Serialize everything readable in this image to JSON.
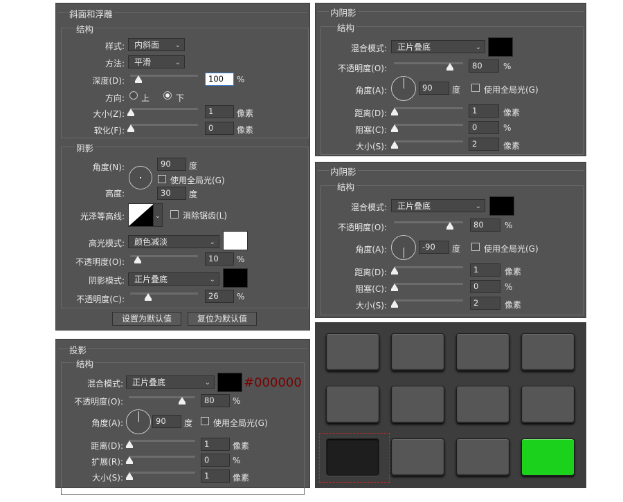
{
  "bevel": {
    "title": "斜面和浮雕",
    "structure_title": "结构",
    "style_label": "样式:",
    "style_value": "内斜面",
    "method_label": "方法:",
    "method_value": "平滑",
    "depth_label": "深度(D):",
    "depth_value": "100",
    "depth_unit": "%",
    "direction_label": "方向:",
    "dir_up": "上",
    "dir_down": "下",
    "size_label": "大小(Z):",
    "size_value": "1",
    "size_unit": "像素",
    "soften_label": "软化(F):",
    "soften_value": "0",
    "soften_unit": "像素",
    "shading_title": "阴影",
    "angle_label": "角度(N):",
    "angle_value": "90",
    "angle_unit": "度",
    "global_light": "使用全局光(G)",
    "altitude_label": "高度:",
    "altitude_value": "30",
    "altitude_unit": "度",
    "gloss_label": "光泽等高线:",
    "antialias": "消除锯齿(L)",
    "highlight_label": "高光模式:",
    "highlight_value": "颜色减淡",
    "highlight_color": "#ffffff",
    "hl_opacity_label": "不透明度(O):",
    "hl_opacity_value": "10",
    "hl_opacity_unit": "%",
    "shadow_mode_label": "阴影模式:",
    "shadow_mode_value": "正片叠底",
    "shadow_color": "#000000",
    "sh_opacity_label": "不透明度(C):",
    "sh_opacity_value": "26",
    "sh_opacity_unit": "%",
    "btn_default": "设置为默认值",
    "btn_reset": "复位为默认值"
  },
  "inner1": {
    "title": "内阴影",
    "structure_title": "结构",
    "blend_label": "混合模式:",
    "blend_value": "正片叠底",
    "color": "#000000",
    "opacity_label": "不透明度(O):",
    "opacity_value": "80",
    "opacity_unit": "%",
    "angle_label": "角度(A):",
    "angle_value": "90",
    "angle_unit": "度",
    "global_light": "使用全局光(G)",
    "distance_label": "距离(D):",
    "distance_value": "1",
    "distance_unit": "像素",
    "choke_label": "阻塞(C):",
    "choke_value": "0",
    "choke_unit": "%",
    "size_label": "大小(S):",
    "size_value": "2",
    "size_unit": "像素"
  },
  "inner2": {
    "title": "内阴影",
    "structure_title": "结构",
    "blend_label": "混合模式:",
    "blend_value": "正片叠底",
    "color": "#000000",
    "opacity_label": "不透明度(O):",
    "opacity_value": "80",
    "opacity_unit": "%",
    "angle_label": "角度(A):",
    "angle_value": "-90",
    "angle_unit": "度",
    "global_light": "使用全局光(G)",
    "distance_label": "距离(D):",
    "distance_value": "1",
    "distance_unit": "像素",
    "choke_label": "阻塞(C):",
    "choke_value": "0",
    "choke_unit": "%",
    "size_label": "大小(S):",
    "size_value": "2",
    "size_unit": "像素"
  },
  "drop": {
    "title": "投影",
    "structure_title": "结构",
    "blend_label": "混合模式:",
    "blend_value": "正片叠底",
    "color": "#000000",
    "hex_label": "#000000",
    "opacity_label": "不透明度(O):",
    "opacity_value": "80",
    "opacity_unit": "%",
    "angle_label": "角度(A):",
    "angle_value": "90",
    "angle_unit": "度",
    "global_light": "使用全局光(G)",
    "distance_label": "距离(D):",
    "distance_value": "1",
    "distance_unit": "像素",
    "spread_label": "扩展(R):",
    "spread_value": "0",
    "spread_unit": "%",
    "size_label": "大小(S):",
    "size_value": "1",
    "size_unit": "像素"
  },
  "preview": {
    "pressed_color": "#1e1e1e",
    "active_color": "#1bd11b",
    "key_color": "#565656"
  }
}
